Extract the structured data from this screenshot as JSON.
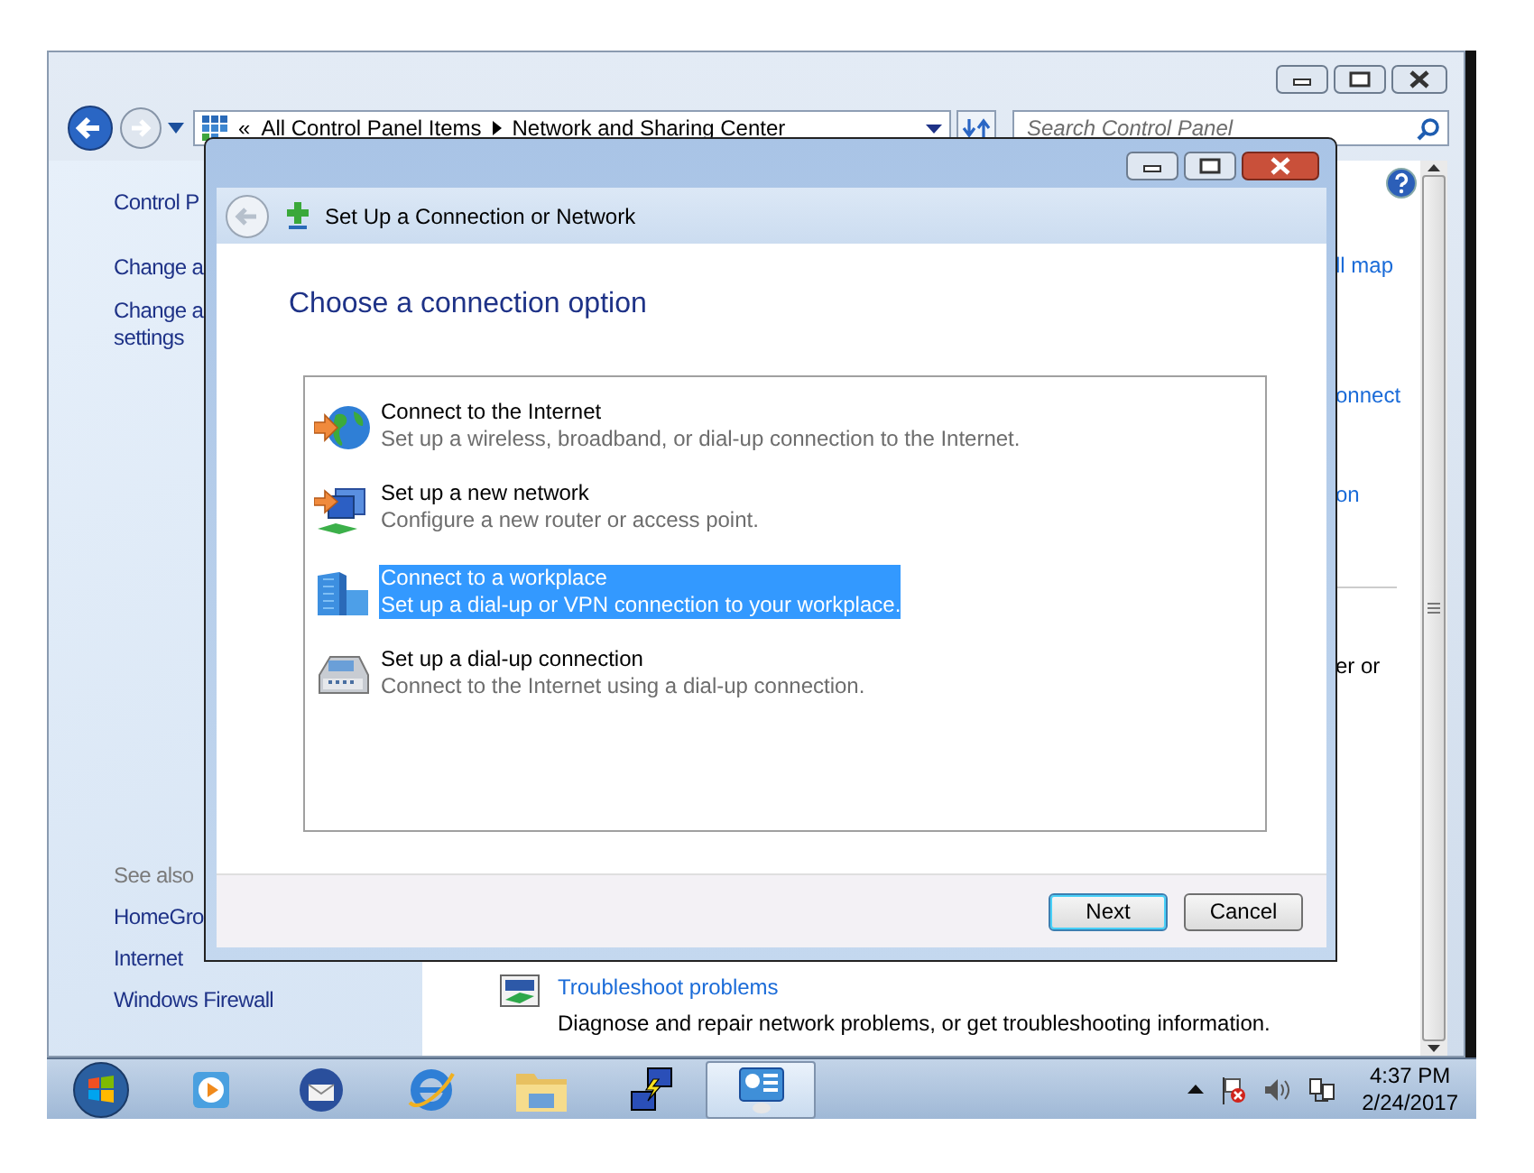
{
  "explorer": {
    "address_bar": {
      "chevron": "«",
      "path": [
        "All Control Panel Items",
        "Network and Sharing Center"
      ]
    },
    "search": {
      "placeholder": "Search Control Panel"
    },
    "left_pane": {
      "links": [
        {
          "lines": [
            "Control P"
          ]
        },
        {
          "lines": [
            "Change a"
          ]
        },
        {
          "lines": [
            "Change a",
            "settings"
          ]
        }
      ],
      "see_also_heading": "See also",
      "see_also": [
        "HomeGro",
        "Internet",
        "Windows Firewall"
      ]
    },
    "content": {
      "fragments": [
        {
          "text": "ll map",
          "kind": "link"
        },
        {
          "text": "onnect",
          "kind": "link"
        },
        {
          "text": "on",
          "kind": "link"
        },
        {
          "text": "er or",
          "kind": "text"
        }
      ],
      "troubleshoot": {
        "title": "Troubleshoot problems",
        "description": "Diagnose and repair network problems, or get troubleshooting information."
      }
    }
  },
  "dialog": {
    "title": "Set Up a Connection or Network",
    "heading": "Choose a connection option",
    "options": [
      {
        "kind": "internet",
        "title": "Connect to the Internet",
        "description": "Set up a wireless, broadband, or dial-up connection to the Internet.",
        "selected": false
      },
      {
        "kind": "network",
        "title": "Set up a new network",
        "description": "Configure a new router or access point.",
        "selected": false
      },
      {
        "kind": "workplace",
        "title": "Connect to a workplace",
        "description": "Set up a dial-up or VPN connection to your workplace.",
        "selected": true
      },
      {
        "kind": "dialup",
        "title": "Set up a dial-up connection",
        "description": "Connect to the Internet using a dial-up connection.",
        "selected": false
      }
    ],
    "buttons": [
      {
        "label": "Next",
        "default": true
      },
      {
        "label": "Cancel",
        "default": false
      }
    ]
  },
  "taskbar": {
    "apps": [
      {
        "kind": "media",
        "selected": false
      },
      {
        "kind": "mail",
        "selected": false
      },
      {
        "kind": "browser",
        "selected": false
      },
      {
        "kind": "folder",
        "selected": false
      },
      {
        "kind": "remote",
        "selected": false
      },
      {
        "kind": "control-panel",
        "selected": true
      }
    ],
    "clock": {
      "time": "4:37 PM",
      "date": "2/24/2017"
    }
  }
}
